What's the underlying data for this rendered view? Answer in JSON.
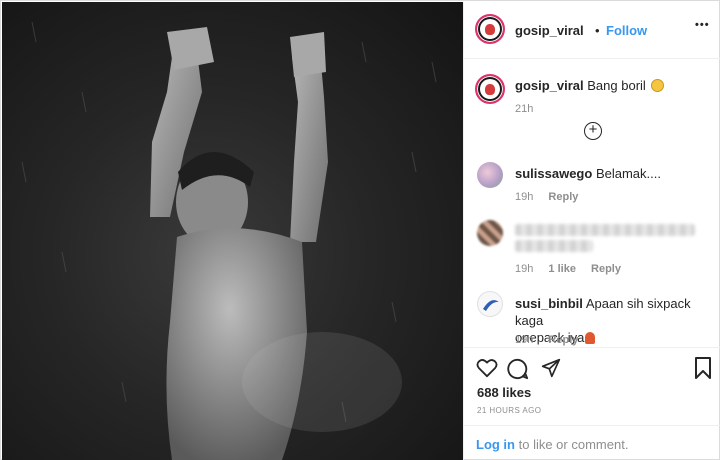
{
  "post": {
    "username": "gosip_viral",
    "separator": "•",
    "follow_label": "Follow",
    "more_label": "•••",
    "caption_username": "gosip_viral",
    "caption_text": "Bang boril",
    "caption_time": "21h",
    "load_more_label": "+"
  },
  "comments": [
    {
      "username": "sulissawego",
      "text": "Belamak....",
      "time": "19h",
      "likes": "",
      "reply": "Reply"
    },
    {
      "username": "",
      "text": "",
      "time": "19h",
      "likes": "1 like",
      "reply": "Reply"
    },
    {
      "username": "susi_binbil",
      "text": "Apaan sih sixpack kaga",
      "text2": "onepack iya",
      "time": "19h",
      "likes": "",
      "reply": "Reply"
    }
  ],
  "actions": {
    "likes_count": "688 likes",
    "timestamp": "21 HOURS AGO",
    "login_link": "Log in",
    "login_suffix": " to like or comment."
  },
  "icons": [
    "heart-icon",
    "comment-icon",
    "share-icon",
    "bookmark-icon",
    "plus-circle-icon"
  ],
  "colors": {
    "accent": "#3897f0",
    "text": "#262626",
    "muted": "#8e8e8e"
  }
}
